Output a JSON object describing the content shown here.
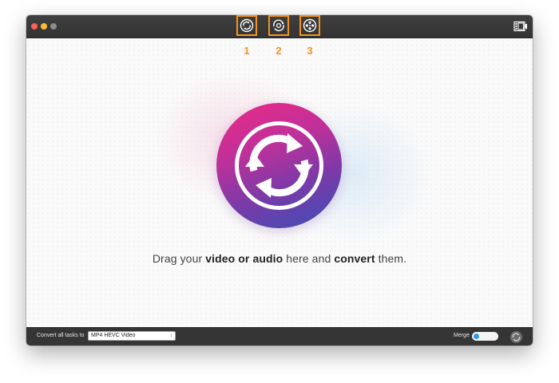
{
  "toolbar": {
    "tools": [
      {
        "name": "convert-tool",
        "icon": "convert-icon"
      },
      {
        "name": "rotate-tool",
        "icon": "rotate-icon"
      },
      {
        "name": "film-tool",
        "icon": "film-reel-icon"
      }
    ],
    "right_icon": "film-strip-icon"
  },
  "annotations": [
    "1",
    "2",
    "3"
  ],
  "main": {
    "drop_prefix": "Drag your ",
    "drop_bold1": "video or audio",
    "drop_middle": " here and ",
    "drop_bold2": "convert",
    "drop_suffix": " them.",
    "logo_icon": "convert-arrows-icon"
  },
  "bottom": {
    "convert_label": "Convert all tasks to",
    "format_value": "MP4 HEVC Video",
    "merge_label": "Merge",
    "merge_on": true
  },
  "colors": {
    "accent": "#f7931e",
    "toggle": "#2f9bf0",
    "logo_gradient": [
      "#ec2a84",
      "#7a3aa8",
      "#3a4fb6"
    ]
  }
}
